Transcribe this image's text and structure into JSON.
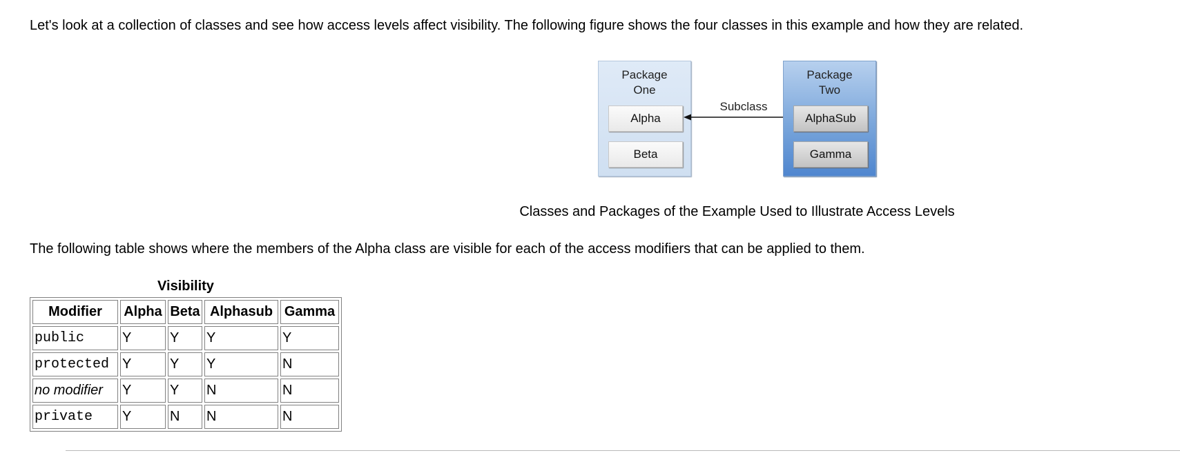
{
  "intro_text": "Let's look at a collection of classes and see how access levels affect visibility. The following figure shows the four classes in this example and how they are related.",
  "figure": {
    "package_one": {
      "title": "Package\nOne",
      "classes": [
        "Alpha",
        "Beta"
      ]
    },
    "package_two": {
      "title": "Package\nTwo",
      "classes": [
        "AlphaSub",
        "Gamma"
      ]
    },
    "relation_label": "Subclass",
    "caption": "Classes and Packages of the Example Used to Illustrate Access Levels"
  },
  "table_intro": "The following table shows where the members of the Alpha class are visible for each of the access modifiers that can be applied to them.",
  "table": {
    "caption": "Visibility",
    "headers": [
      "Modifier",
      "Alpha",
      "Beta",
      "Alphasub",
      "Gamma"
    ],
    "rows": [
      {
        "modifier": "public",
        "style": "code",
        "cells": [
          "Y",
          "Y",
          "Y",
          "Y"
        ]
      },
      {
        "modifier": "protected",
        "style": "code",
        "cells": [
          "Y",
          "Y",
          "Y",
          "N"
        ]
      },
      {
        "modifier": "no modifier",
        "style": "italic",
        "cells": [
          "Y",
          "Y",
          "N",
          "N"
        ]
      },
      {
        "modifier": "private",
        "style": "code",
        "cells": [
          "Y",
          "N",
          "N",
          "N"
        ]
      }
    ]
  },
  "colors": {
    "package_one_fill": "#dfeaf7",
    "package_two_fill": "#7aa6db",
    "table_border": "#808080"
  }
}
